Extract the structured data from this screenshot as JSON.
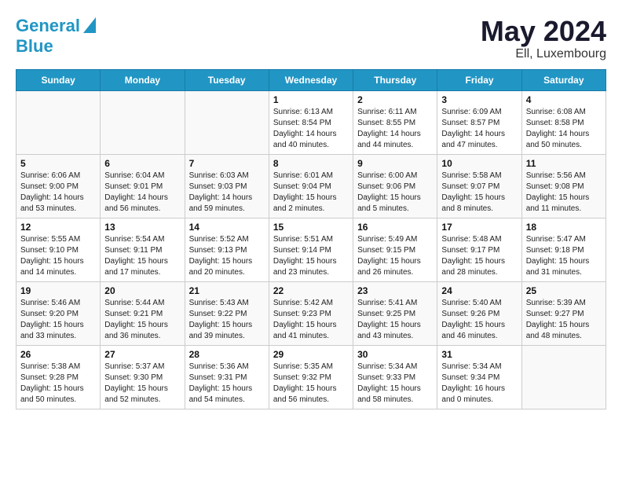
{
  "header": {
    "logo_line1": "General",
    "logo_line2": "Blue",
    "month": "May 2024",
    "location": "Ell, Luxembourg"
  },
  "weekdays": [
    "Sunday",
    "Monday",
    "Tuesday",
    "Wednesday",
    "Thursday",
    "Friday",
    "Saturday"
  ],
  "weeks": [
    [
      {
        "day": "",
        "info": ""
      },
      {
        "day": "",
        "info": ""
      },
      {
        "day": "",
        "info": ""
      },
      {
        "day": "1",
        "info": "Sunrise: 6:13 AM\nSunset: 8:54 PM\nDaylight: 14 hours\nand 40 minutes."
      },
      {
        "day": "2",
        "info": "Sunrise: 6:11 AM\nSunset: 8:55 PM\nDaylight: 14 hours\nand 44 minutes."
      },
      {
        "day": "3",
        "info": "Sunrise: 6:09 AM\nSunset: 8:57 PM\nDaylight: 14 hours\nand 47 minutes."
      },
      {
        "day": "4",
        "info": "Sunrise: 6:08 AM\nSunset: 8:58 PM\nDaylight: 14 hours\nand 50 minutes."
      }
    ],
    [
      {
        "day": "5",
        "info": "Sunrise: 6:06 AM\nSunset: 9:00 PM\nDaylight: 14 hours\nand 53 minutes."
      },
      {
        "day": "6",
        "info": "Sunrise: 6:04 AM\nSunset: 9:01 PM\nDaylight: 14 hours\nand 56 minutes."
      },
      {
        "day": "7",
        "info": "Sunrise: 6:03 AM\nSunset: 9:03 PM\nDaylight: 14 hours\nand 59 minutes."
      },
      {
        "day": "8",
        "info": "Sunrise: 6:01 AM\nSunset: 9:04 PM\nDaylight: 15 hours\nand 2 minutes."
      },
      {
        "day": "9",
        "info": "Sunrise: 6:00 AM\nSunset: 9:06 PM\nDaylight: 15 hours\nand 5 minutes."
      },
      {
        "day": "10",
        "info": "Sunrise: 5:58 AM\nSunset: 9:07 PM\nDaylight: 15 hours\nand 8 minutes."
      },
      {
        "day": "11",
        "info": "Sunrise: 5:56 AM\nSunset: 9:08 PM\nDaylight: 15 hours\nand 11 minutes."
      }
    ],
    [
      {
        "day": "12",
        "info": "Sunrise: 5:55 AM\nSunset: 9:10 PM\nDaylight: 15 hours\nand 14 minutes."
      },
      {
        "day": "13",
        "info": "Sunrise: 5:54 AM\nSunset: 9:11 PM\nDaylight: 15 hours\nand 17 minutes."
      },
      {
        "day": "14",
        "info": "Sunrise: 5:52 AM\nSunset: 9:13 PM\nDaylight: 15 hours\nand 20 minutes."
      },
      {
        "day": "15",
        "info": "Sunrise: 5:51 AM\nSunset: 9:14 PM\nDaylight: 15 hours\nand 23 minutes."
      },
      {
        "day": "16",
        "info": "Sunrise: 5:49 AM\nSunset: 9:15 PM\nDaylight: 15 hours\nand 26 minutes."
      },
      {
        "day": "17",
        "info": "Sunrise: 5:48 AM\nSunset: 9:17 PM\nDaylight: 15 hours\nand 28 minutes."
      },
      {
        "day": "18",
        "info": "Sunrise: 5:47 AM\nSunset: 9:18 PM\nDaylight: 15 hours\nand 31 minutes."
      }
    ],
    [
      {
        "day": "19",
        "info": "Sunrise: 5:46 AM\nSunset: 9:20 PM\nDaylight: 15 hours\nand 33 minutes."
      },
      {
        "day": "20",
        "info": "Sunrise: 5:44 AM\nSunset: 9:21 PM\nDaylight: 15 hours\nand 36 minutes."
      },
      {
        "day": "21",
        "info": "Sunrise: 5:43 AM\nSunset: 9:22 PM\nDaylight: 15 hours\nand 39 minutes."
      },
      {
        "day": "22",
        "info": "Sunrise: 5:42 AM\nSunset: 9:23 PM\nDaylight: 15 hours\nand 41 minutes."
      },
      {
        "day": "23",
        "info": "Sunrise: 5:41 AM\nSunset: 9:25 PM\nDaylight: 15 hours\nand 43 minutes."
      },
      {
        "day": "24",
        "info": "Sunrise: 5:40 AM\nSunset: 9:26 PM\nDaylight: 15 hours\nand 46 minutes."
      },
      {
        "day": "25",
        "info": "Sunrise: 5:39 AM\nSunset: 9:27 PM\nDaylight: 15 hours\nand 48 minutes."
      }
    ],
    [
      {
        "day": "26",
        "info": "Sunrise: 5:38 AM\nSunset: 9:28 PM\nDaylight: 15 hours\nand 50 minutes."
      },
      {
        "day": "27",
        "info": "Sunrise: 5:37 AM\nSunset: 9:30 PM\nDaylight: 15 hours\nand 52 minutes."
      },
      {
        "day": "28",
        "info": "Sunrise: 5:36 AM\nSunset: 9:31 PM\nDaylight: 15 hours\nand 54 minutes."
      },
      {
        "day": "29",
        "info": "Sunrise: 5:35 AM\nSunset: 9:32 PM\nDaylight: 15 hours\nand 56 minutes."
      },
      {
        "day": "30",
        "info": "Sunrise: 5:34 AM\nSunset: 9:33 PM\nDaylight: 15 hours\nand 58 minutes."
      },
      {
        "day": "31",
        "info": "Sunrise: 5:34 AM\nSunset: 9:34 PM\nDaylight: 16 hours\nand 0 minutes."
      },
      {
        "day": "",
        "info": ""
      }
    ]
  ]
}
